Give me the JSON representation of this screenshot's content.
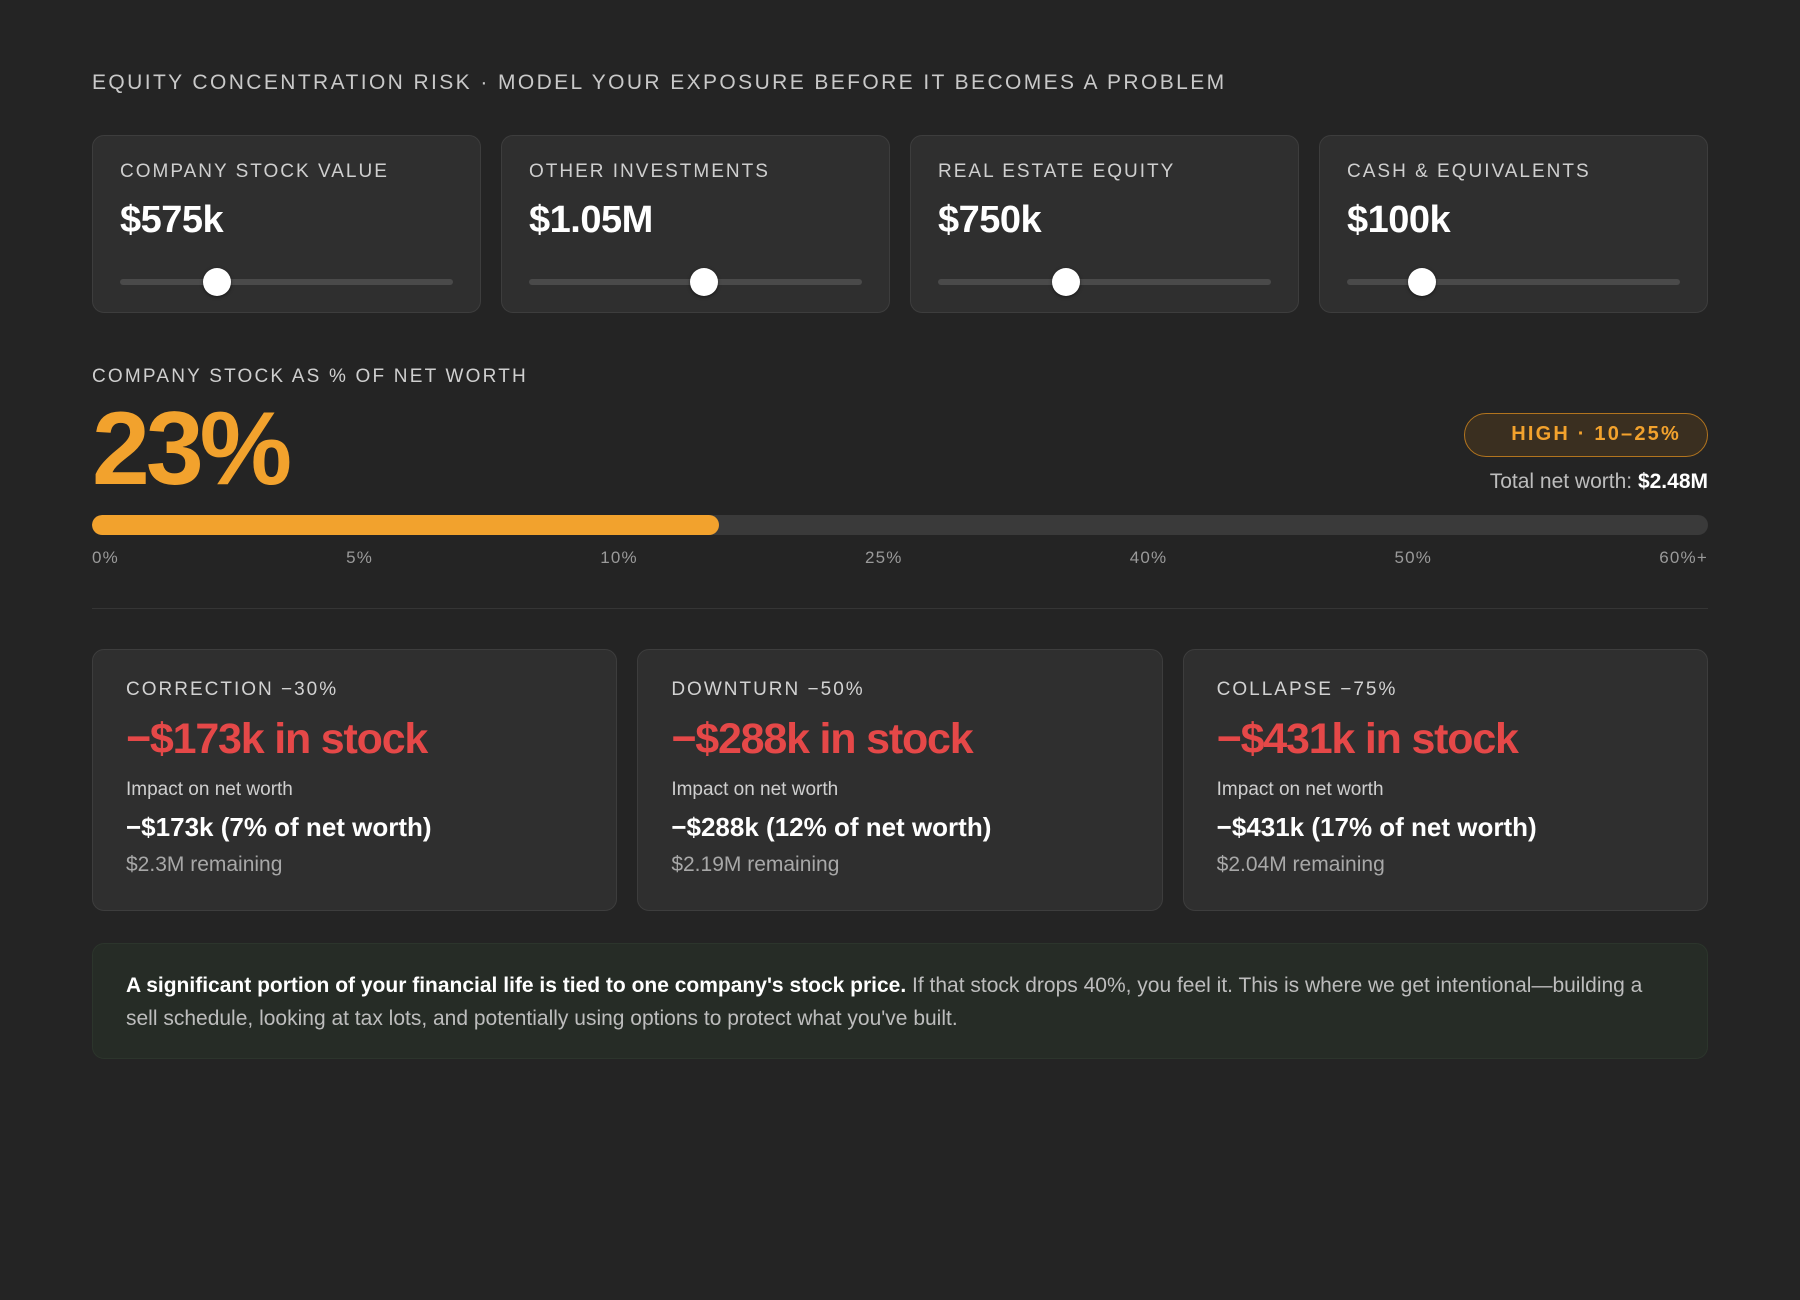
{
  "header": {
    "eyebrow": "EQUITY CONCENTRATION RISK · MODEL YOUR EXPOSURE BEFORE IT BECOMES A PROBLEM"
  },
  "inputs": [
    {
      "label": "COMPANY STOCK VALUE",
      "value": "$575k",
      "slider_position": 0.29
    },
    {
      "label": "OTHER INVESTMENTS",
      "value": "$1.05M",
      "slider_position": 0.525
    },
    {
      "label": "REAL ESTATE EQUITY",
      "value": "$750k",
      "slider_position": 0.385
    },
    {
      "label": "CASH & EQUIVALENTS",
      "value": "$100k",
      "slider_position": 0.225
    }
  ],
  "concentration": {
    "label": "COMPANY STOCK AS % OF NET WORTH",
    "value": "23%",
    "risk_badge": "HIGH · 10–25%",
    "net_worth_label": "Total net worth:",
    "net_worth_value": "$2.48M",
    "bar_fill_fraction": 0.388,
    "ticks": [
      "0%",
      "5%",
      "10%",
      "25%",
      "40%",
      "50%",
      "60%+"
    ]
  },
  "scenarios": [
    {
      "label": "CORRECTION −30%",
      "loss": "−$173k in stock",
      "impact_label": "Impact on net worth",
      "impact": "−$173k (7% of net worth)",
      "remaining": "$2.3M remaining"
    },
    {
      "label": "DOWNTURN −50%",
      "loss": "−$288k in stock",
      "impact_label": "Impact on net worth",
      "impact": "−$288k (12% of net worth)",
      "remaining": "$2.19M remaining"
    },
    {
      "label": "COLLAPSE −75%",
      "loss": "−$431k in stock",
      "impact_label": "Impact on net worth",
      "impact": "−$431k (17% of net worth)",
      "remaining": "$2.04M remaining"
    }
  ],
  "note": {
    "bold": "A significant portion of your financial life is tied to one company's stock price.",
    "text": " If that stock drops 40%, you feel it. This is where we get intentional—building a sell schedule, looking at tax lots, and potentially using options to protect what you've built."
  },
  "colors": {
    "background": "#242424",
    "accent": "#f2a22d",
    "loss": "#e54848",
    "card": "#2f2f2f"
  }
}
